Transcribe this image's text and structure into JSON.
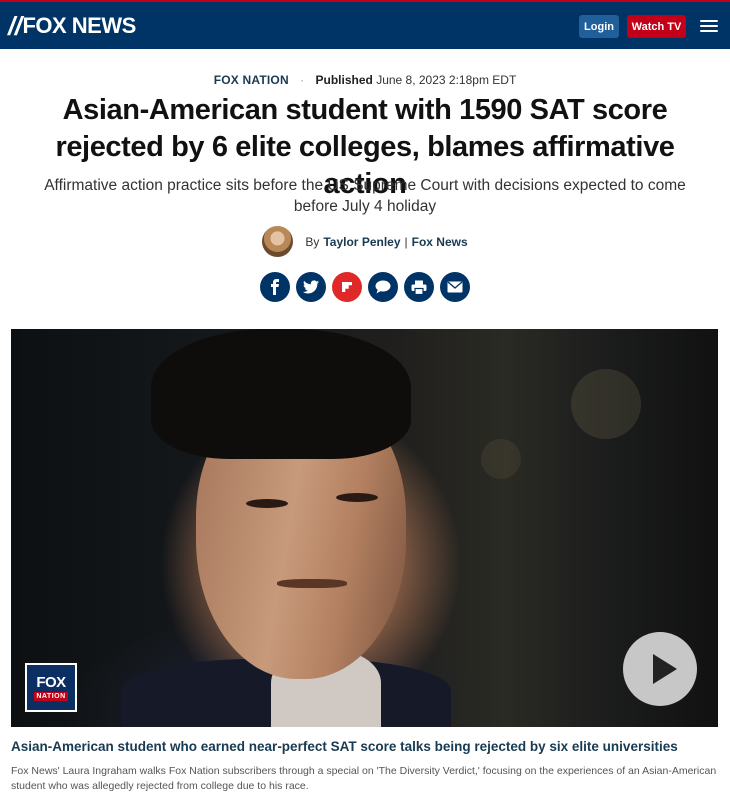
{
  "header": {
    "logo_text": "FOX NEWS",
    "login_label": "Login",
    "watch_label": "Watch TV",
    "menu_icon": "hamburger-icon",
    "colors": {
      "bar": "#003366",
      "accent": "#c20017"
    }
  },
  "article": {
    "section": "FOX NATION",
    "published_label": "Published",
    "published_date": "June 8, 2023 2:18pm EDT",
    "headline": "Asian-American student with 1590 SAT score rejected by 6 elite colleges, blames affirmative action",
    "subhead": "Affirmative action practice sits before the US Supreme Court with decisions expected to come before July 4 holiday",
    "byline_prefix": "By",
    "author": "Taylor Penley",
    "byline_sep": "|",
    "outlet": "Fox News"
  },
  "share": {
    "icons": [
      "facebook-icon",
      "twitter-icon",
      "flipboard-icon",
      "comment-icon",
      "print-icon",
      "email-icon"
    ]
  },
  "video": {
    "badge_line1": "FOX",
    "badge_line2": "NATION",
    "caption_title": "Asian-American student who earned near-perfect SAT score talks being rejected by six elite universities",
    "caption_text": "Fox News' Laura Ingraham walks Fox Nation subscribers through a special on 'The Diversity Verdict,' focusing on the experiences of an Asian-American student who was allegedly rejected from college due to his race."
  }
}
